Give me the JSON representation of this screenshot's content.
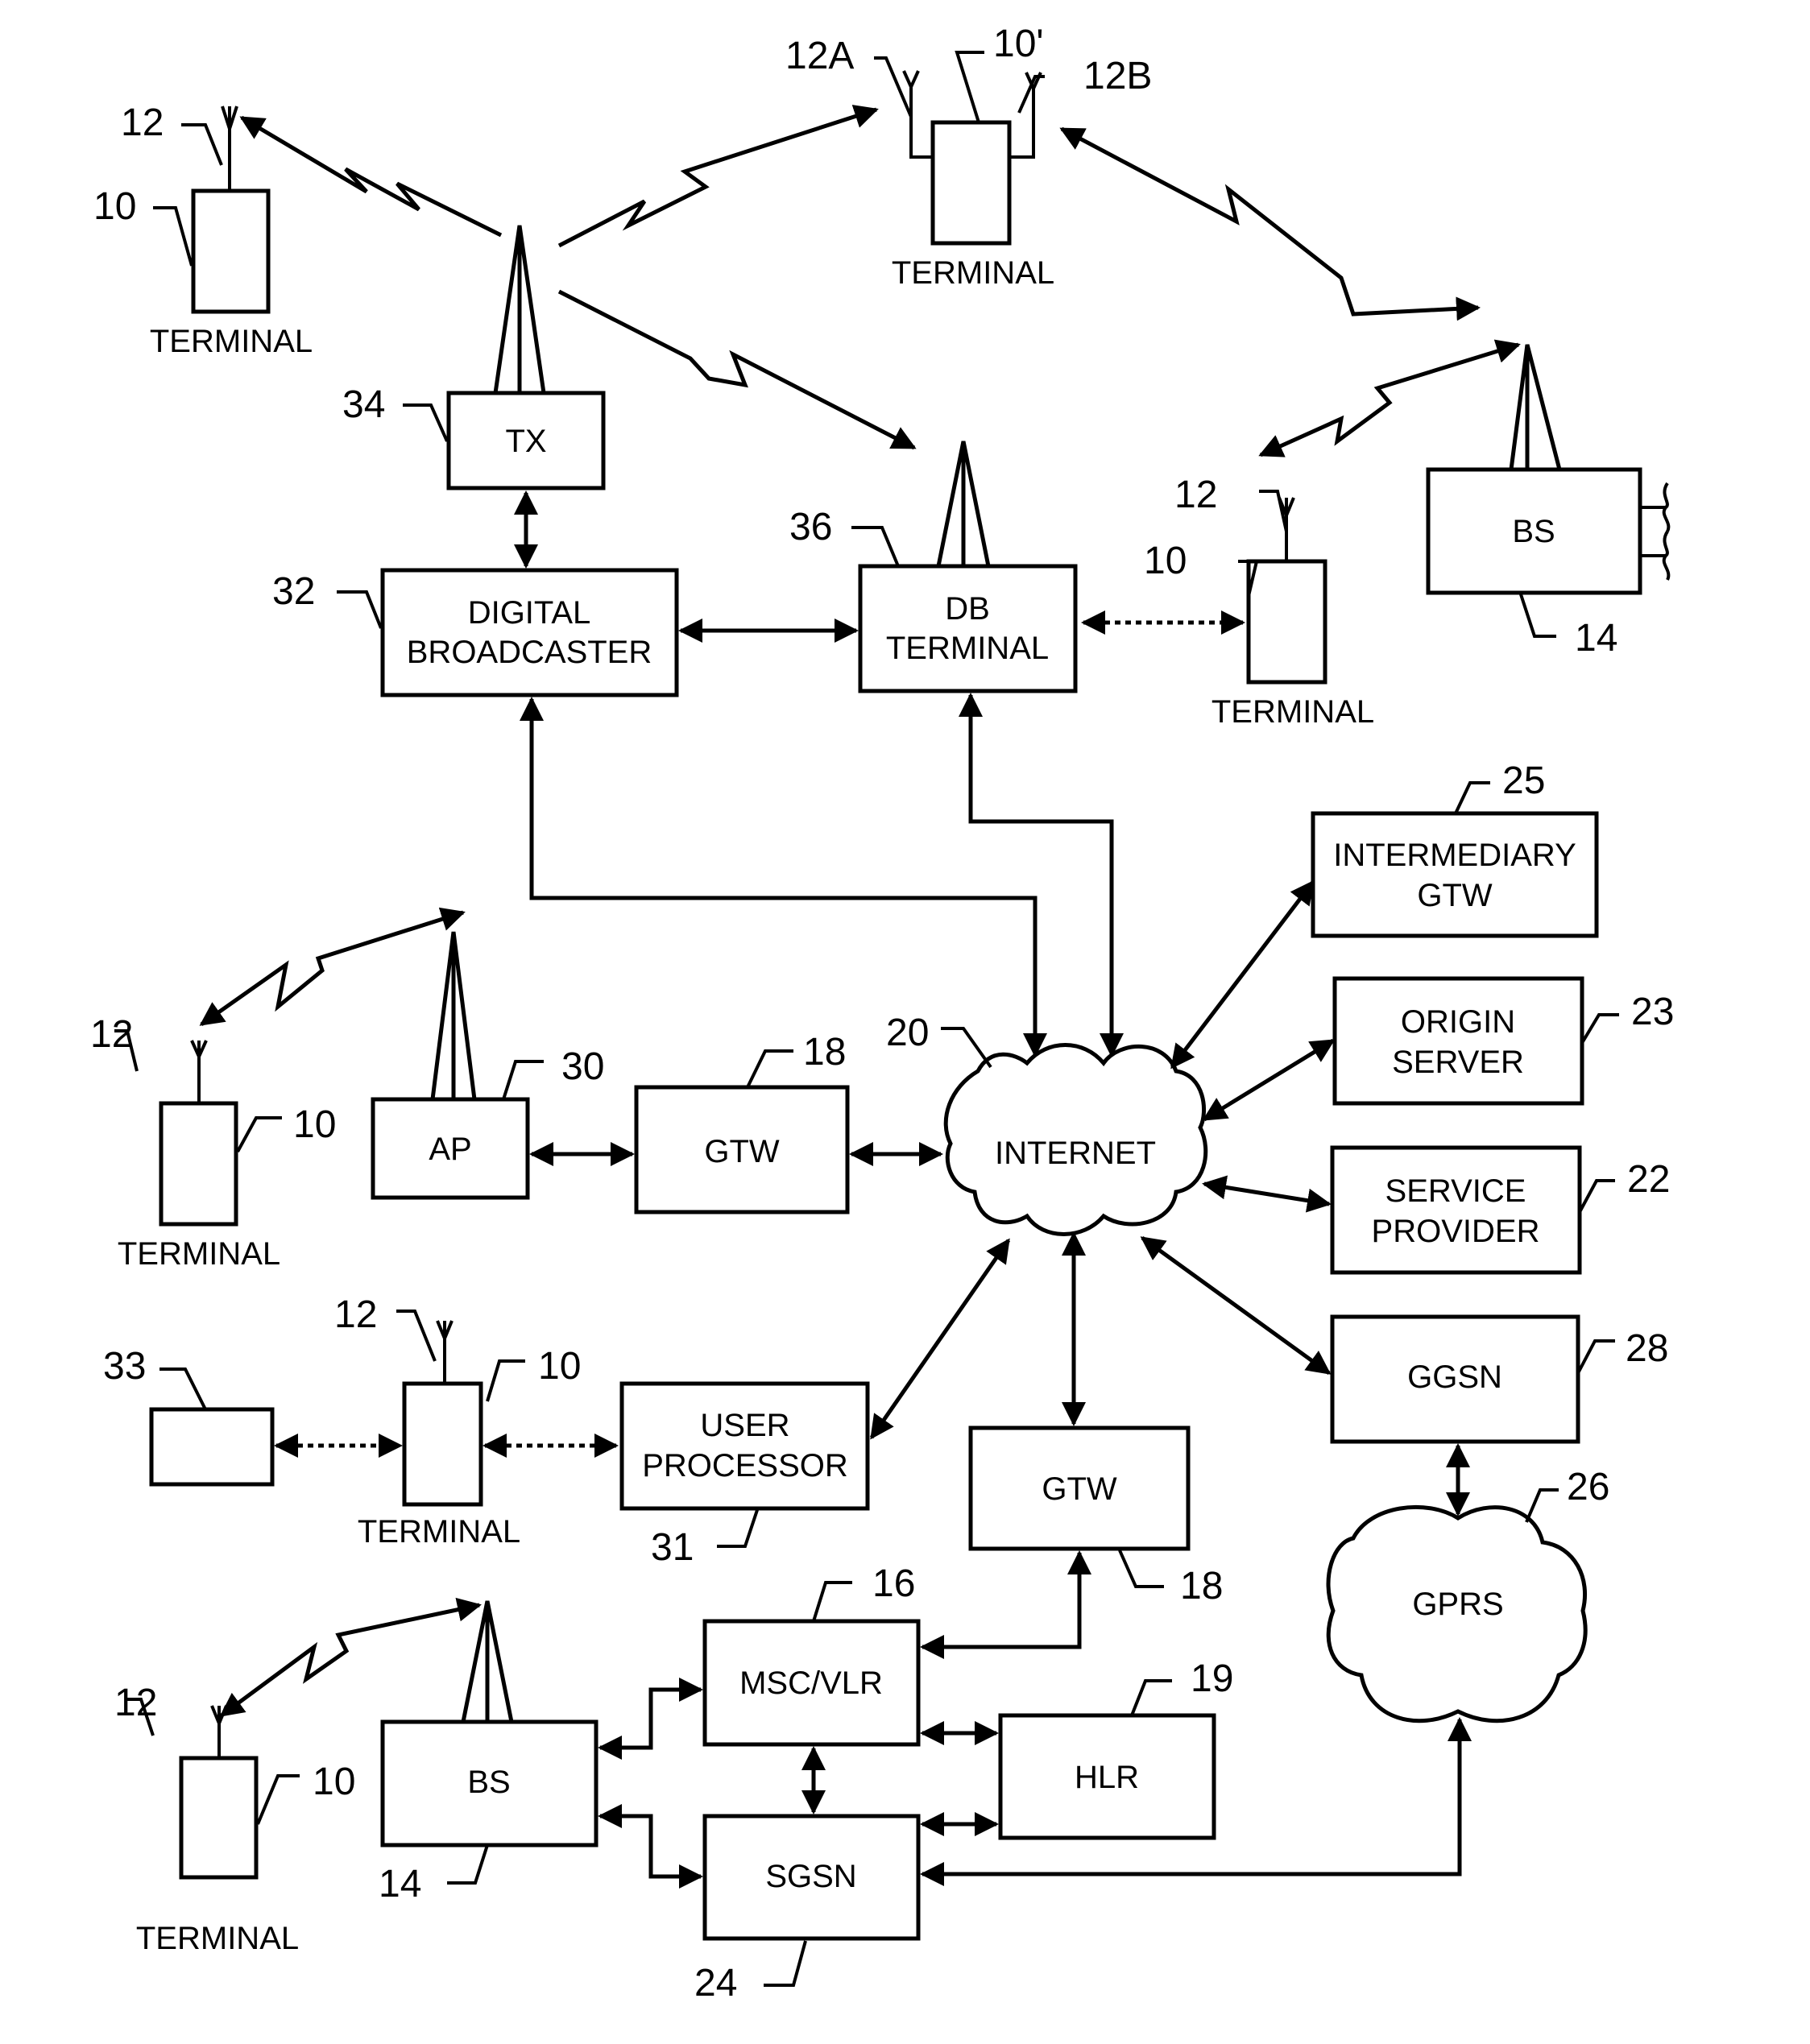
{
  "diagram": {
    "type": "network-architecture-patent-figure",
    "colors": {
      "line": "#000000",
      "background": "#ffffff"
    },
    "nodes": {
      "tx": {
        "label": "TX",
        "ref": "34"
      },
      "digital_broadcaster": {
        "line1": "DIGITAL",
        "line2": "BROADCASTER",
        "ref": "32"
      },
      "db_terminal": {
        "line1": "DB",
        "line2": "TERMINAL",
        "ref": "36"
      },
      "bs_top": {
        "label": "BS",
        "ref": "14"
      },
      "terminal_top_left": {
        "caption": "TERMINAL",
        "ref": "10",
        "antenna_ref": "12"
      },
      "terminal_dual": {
        "caption": "TERMINAL",
        "ref": "10'",
        "antenna_a_ref": "12A",
        "antenna_b_ref": "12B"
      },
      "terminal_db": {
        "caption": "TERMINAL",
        "ref": "10",
        "antenna_ref": "12"
      },
      "intermediary_gtw": {
        "line1": "INTERMEDIARY",
        "line2": "GTW",
        "ref": "25"
      },
      "origin_server": {
        "line1": "ORIGIN",
        "line2": "SERVER",
        "ref": "23"
      },
      "service_provider": {
        "line1": "SERVICE",
        "line2": "PROVIDER",
        "ref": "22"
      },
      "internet": {
        "label": "INTERNET",
        "ref": "20"
      },
      "ap": {
        "label": "AP",
        "ref": "30"
      },
      "gtw_ap": {
        "label": "GTW",
        "ref": "18"
      },
      "terminal_ap": {
        "caption": "TERMINAL",
        "ref": "10",
        "antenna_ref": "12"
      },
      "ggsn": {
        "label": "GGSN",
        "ref": "28"
      },
      "gprs": {
        "label": "GPRS",
        "ref": "26"
      },
      "device_33": {
        "label": "",
        "ref": "33"
      },
      "terminal_user": {
        "caption": "TERMINAL",
        "ref": "10",
        "antenna_ref": "12"
      },
      "user_processor": {
        "line1": "USER",
        "line2": "PROCESSOR",
        "ref": "31"
      },
      "gtw_msc": {
        "label": "GTW",
        "ref": "18"
      },
      "msc_vlr": {
        "label": "MSC/VLR",
        "ref": "16"
      },
      "hlr": {
        "label": "HLR",
        "ref": "19"
      },
      "bs_bottom": {
        "label": "BS",
        "ref": "14"
      },
      "sgsn": {
        "label": "SGSN",
        "ref": "24"
      },
      "terminal_bottom": {
        "caption": "TERMINAL",
        "ref": "10",
        "antenna_ref": "12"
      }
    },
    "links": [
      {
        "from": "tx",
        "to": "terminal_top_left",
        "kind": "wireless"
      },
      {
        "from": "tx",
        "to": "terminal_dual",
        "kind": "wireless"
      },
      {
        "from": "tx",
        "to": "db_terminal",
        "kind": "wireless"
      },
      {
        "from": "bs_top",
        "to": "terminal_dual",
        "kind": "wireless-bidirectional"
      },
      {
        "from": "bs_top",
        "to": "terminal_db",
        "kind": "wireless-bidirectional"
      },
      {
        "from": "tx",
        "to": "digital_broadcaster",
        "kind": "bidirectional"
      },
      {
        "from": "digital_broadcaster",
        "to": "db_terminal",
        "kind": "bidirectional"
      },
      {
        "from": "db_terminal",
        "to": "terminal_db",
        "kind": "dashed-bidirectional"
      },
      {
        "from": "digital_broadcaster",
        "to": "internet",
        "kind": "bidirectional"
      },
      {
        "from": "db_terminal",
        "to": "internet",
        "kind": "bidirectional"
      },
      {
        "from": "internet",
        "to": "intermediary_gtw",
        "kind": "bidirectional"
      },
      {
        "from": "internet",
        "to": "origin_server",
        "kind": "bidirectional"
      },
      {
        "from": "internet",
        "to": "service_provider",
        "kind": "bidirectional"
      },
      {
        "from": "internet",
        "to": "ggsn",
        "kind": "bidirectional"
      },
      {
        "from": "ap",
        "to": "terminal_ap",
        "kind": "wireless-bidirectional"
      },
      {
        "from": "ap",
        "to": "gtw_ap",
        "kind": "bidirectional"
      },
      {
        "from": "gtw_ap",
        "to": "internet",
        "kind": "bidirectional"
      },
      {
        "from": "internet",
        "to": "user_processor",
        "kind": "bidirectional"
      },
      {
        "from": "internet",
        "to": "gtw_msc",
        "kind": "bidirectional"
      },
      {
        "from": "device_33",
        "to": "terminal_user",
        "kind": "dashed-bidirectional"
      },
      {
        "from": "terminal_user",
        "to": "user_processor",
        "kind": "dashed-bidirectional"
      },
      {
        "from": "ggsn",
        "to": "gprs",
        "kind": "bidirectional"
      },
      {
        "from": "gtw_msc",
        "to": "msc_vlr",
        "kind": "bidirectional"
      },
      {
        "from": "msc_vlr",
        "to": "hlr",
        "kind": "bidirectional"
      },
      {
        "from": "sgsn",
        "to": "hlr",
        "kind": "bidirectional"
      },
      {
        "from": "msc_vlr",
        "to": "sgsn",
        "kind": "bidirectional"
      },
      {
        "from": "bs_bottom",
        "to": "msc_vlr",
        "kind": "bidirectional"
      },
      {
        "from": "bs_bottom",
        "to": "sgsn",
        "kind": "bidirectional"
      },
      {
        "from": "sgsn",
        "to": "gprs",
        "kind": "bidirectional"
      },
      {
        "from": "bs_bottom",
        "to": "terminal_bottom",
        "kind": "wireless-bidirectional"
      }
    ]
  }
}
